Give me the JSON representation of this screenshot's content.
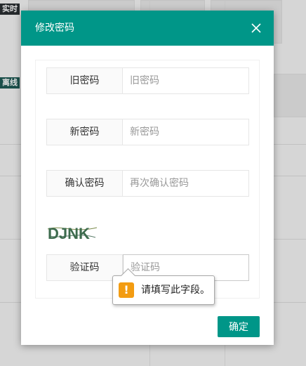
{
  "background": {
    "tag_realtime": "实时",
    "tag_offline": "离线"
  },
  "dialog": {
    "title": "修改密码",
    "close_icon": "close-icon",
    "fields": [
      {
        "label": "旧密码",
        "placeholder": "旧密码",
        "value": ""
      },
      {
        "label": "新密码",
        "placeholder": "新密码",
        "value": ""
      },
      {
        "label": "确认密码",
        "placeholder": "再次确认密码",
        "value": ""
      },
      {
        "label": "验证码",
        "placeholder": "验证码",
        "value": ""
      }
    ],
    "captcha_text": "DJNK",
    "validation_message": "请填写此字段。",
    "validation_icon": "warning-icon",
    "confirm_label": "确定"
  },
  "colors": {
    "accent": "#009688",
    "warning": "#f39c12"
  }
}
